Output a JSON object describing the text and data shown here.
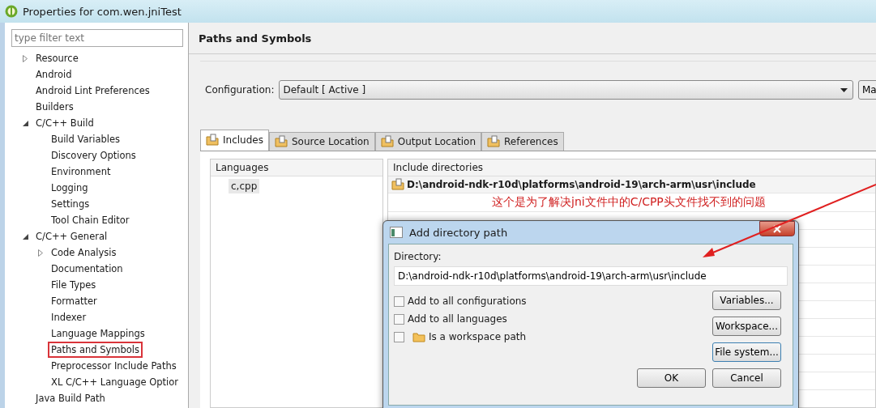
{
  "window": {
    "title": "Properties for com.wen.jniTest"
  },
  "filter": {
    "placeholder": "type filter text"
  },
  "tree": [
    {
      "label": "Resource",
      "expanded": false
    },
    {
      "label": "Android"
    },
    {
      "label": "Android Lint Preferences"
    },
    {
      "label": "Builders"
    },
    {
      "label": "C/C++ Build",
      "expanded": true,
      "children": [
        {
          "label": "Build Variables"
        },
        {
          "label": "Discovery Options"
        },
        {
          "label": "Environment"
        },
        {
          "label": "Logging"
        },
        {
          "label": "Settings"
        },
        {
          "label": "Tool Chain Editor"
        }
      ]
    },
    {
      "label": "C/C++ General",
      "expanded": true,
      "children": [
        {
          "label": "Code Analysis",
          "expanded": false
        },
        {
          "label": "Documentation"
        },
        {
          "label": "File Types"
        },
        {
          "label": "Formatter"
        },
        {
          "label": "Indexer"
        },
        {
          "label": "Language Mappings"
        },
        {
          "label": "Paths and Symbols",
          "annotated": true
        },
        {
          "label": "Preprocessor Include Paths"
        },
        {
          "label": "XL C/C++ Language Optior"
        }
      ]
    },
    {
      "label": "Java Build Path"
    }
  ],
  "page_title": "Paths and Symbols",
  "configuration": {
    "label": "Configuration:",
    "value": "Default  [ Active ]",
    "manage_button": "Ma"
  },
  "tabs": [
    {
      "label": "Includes",
      "selected": true
    },
    {
      "label": "Source Location",
      "selected": false
    },
    {
      "label": "Output Location",
      "selected": false
    },
    {
      "label": "References",
      "selected": false
    }
  ],
  "languages": {
    "header": "Languages",
    "items": [
      {
        "label": "c,cpp",
        "selected": true
      }
    ]
  },
  "include_directories": {
    "header": "Include directories",
    "items": [
      {
        "path": "D:\\android-ndk-r10d\\platforms\\android-19\\arch-arm\\usr\\include"
      }
    ]
  },
  "annotation": {
    "text": "这个是为了解决jni文件中的C/CPP头文件找不到的问题"
  },
  "dialog": {
    "title": "Add directory path",
    "directory_label": "Directory:",
    "directory_value": "D:\\android-ndk-r10d\\platforms\\android-19\\arch-arm\\usr\\include",
    "options": [
      {
        "label": "Add to all configurations",
        "checked": false
      },
      {
        "label": "Add to all languages",
        "checked": false
      },
      {
        "label": "Is a workspace path",
        "checked": false,
        "folder_icon": true
      }
    ],
    "side_buttons": [
      "Variables...",
      "Workspace...",
      "File system..."
    ],
    "buttons": [
      "OK",
      "Cancel"
    ]
  }
}
